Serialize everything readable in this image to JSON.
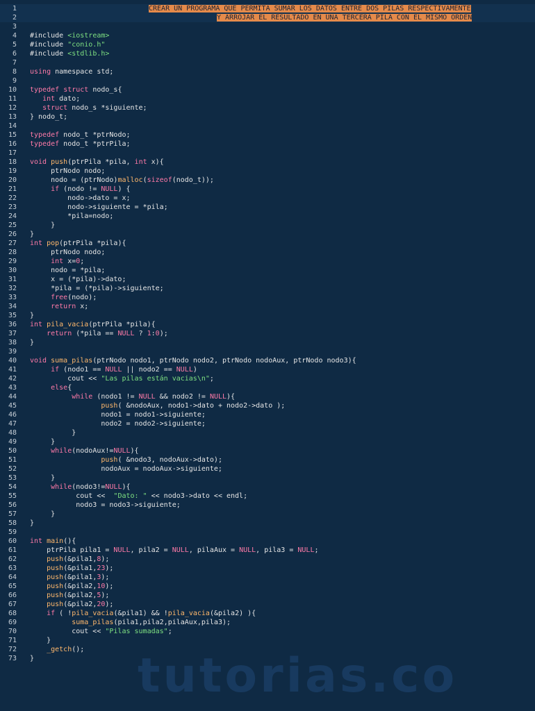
{
  "header": {
    "comment_line1": "CREAR UN PROGRAMA QUE PERMITA SUMAR LOS DATOS ENTRE DOS PILAS RESPECTIVAMENTE",
    "comment_line2": "Y ARROJAR EL RESULTADO EN UNA TERCERA PILA CON EL MISMO ORDEN"
  },
  "lines": [
    "",
    "",
    "",
    "#include <iostream>",
    "#include \"conio.h\"",
    "#include <stdlib.h>",
    "",
    "using namespace std;",
    "",
    "typedef struct nodo_s{",
    "   int dato;",
    "   struct nodo_s *siguiente;",
    "} nodo_t;",
    "",
    "typedef nodo_t *ptrNodo;",
    "typedef nodo_t *ptrPila;",
    "",
    "void push(ptrPila *pila, int x){",
    "     ptrNodo nodo;",
    "     nodo = (ptrNodo)malloc(sizeof(nodo_t));",
    "     if (nodo != NULL) {",
    "         nodo->dato = x;",
    "         nodo->siguiente = *pila;",
    "         *pila=nodo;",
    "     }",
    "}",
    "int pop(ptrPila *pila){",
    "     ptrNodo nodo;",
    "     int x=0;",
    "     nodo = *pila;",
    "     x = (*pila)->dato;",
    "     *pila = (*pila)->siguiente;",
    "     free(nodo);",
    "     return x;",
    "}",
    "int pila_vacia(ptrPila *pila){",
    "    return (*pila == NULL ? 1:0);",
    "}",
    "",
    "void suma_pilas(ptrNodo nodo1, ptrNodo nodo2, ptrNodo nodoAux, ptrNodo nodo3){",
    "     if (nodo1 == NULL || nodo2 == NULL)",
    "         cout << \"Las pilas están vacias\\n\";",
    "     else{",
    "          while (nodo1 != NULL && nodo2 != NULL){",
    "                 push( &nodoAux, nodo1->dato + nodo2->dato );",
    "                 nodo1 = nodo1->siguiente;",
    "                 nodo2 = nodo2->siguiente;",
    "          }",
    "     }",
    "     while(nodoAux!=NULL){",
    "                 push( &nodo3, nodoAux->dato);",
    "                 nodoAux = nodoAux->siguiente;",
    "     }",
    "     while(nodo3!=NULL){",
    "           cout <<  \"Dato: \" << nodo3->dato << endl;",
    "           nodo3 = nodo3->siguiente;",
    "     }",
    "}",
    "",
    "int main(){",
    "    ptrPila pila1 = NULL, pila2 = NULL, pilaAux = NULL, pila3 = NULL;",
    "    push(&pila1,8);",
    "    push(&pila1,23);",
    "    push(&pila1,3);",
    "    push(&pila2,10);",
    "    push(&pila2,5);",
    "    push(&pila2,20);",
    "    if ( !pila_vacia(&pila1) && !pila_vacia(&pila2) ){",
    "          suma_pilas(pila1,pila2,pilaAux,pila3);",
    "          cout << \"Pilas sumadas\";",
    "    }",
    "    _getch();",
    "}"
  ],
  "watermark": "tutorias.co",
  "colors": {
    "background": "#0f2a44",
    "keyword": "#ff7aa8",
    "function": "#ffb86c",
    "string": "#7ee081",
    "comment_highlight": "#e58a4a"
  }
}
